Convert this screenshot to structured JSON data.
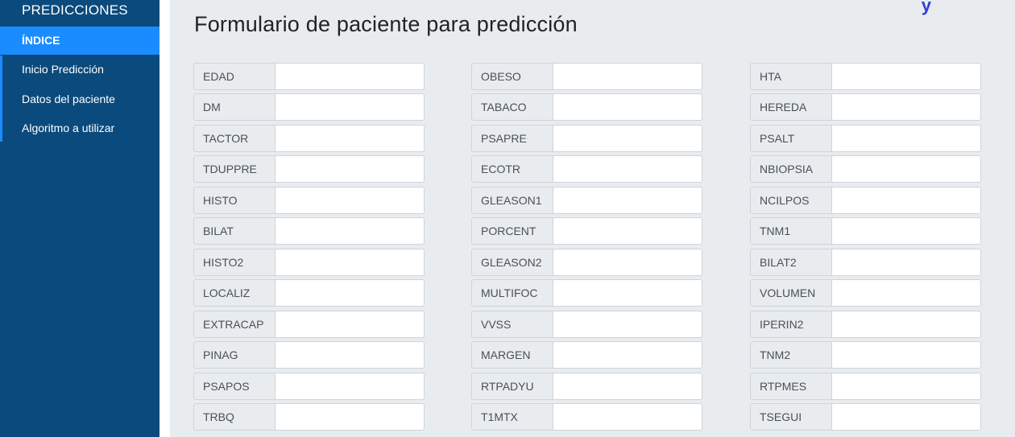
{
  "sidebar": {
    "title": "PREDICCIONES",
    "active_item": "ÍNDICE",
    "items": [
      {
        "label": "Inicio Predicción"
      },
      {
        "label": "Datos del paciente"
      },
      {
        "label": "Algoritmo a utilizar"
      }
    ]
  },
  "main": {
    "title": "Formulario de paciente para predicción",
    "corner_mark": "y"
  },
  "form": {
    "rows": [
      [
        "EDAD",
        "OBESO",
        "HTA"
      ],
      [
        "DM",
        "TABACO",
        "HEREDA"
      ],
      [
        "TACTOR",
        "PSAPRE",
        "PSALT"
      ],
      [
        "TDUPPRE",
        "ECOTR",
        "NBIOPSIA"
      ],
      [
        "HISTO",
        "GLEASON1",
        "NCILPOS"
      ],
      [
        "BILAT",
        "PORCENT",
        "TNM1"
      ],
      [
        "HISTO2",
        "GLEASON2",
        "BILAT2"
      ],
      [
        "LOCALIZ",
        "MULTIFOC",
        "VOLUMEN"
      ],
      [
        "EXTRACAP",
        "VVSS",
        "IPERIN2"
      ],
      [
        "PINAG",
        "MARGEN",
        "TNM2"
      ],
      [
        "PSAPOS",
        "RTPADYU",
        "RTPMES"
      ],
      [
        "TRBQ",
        "T1MTX",
        "TSEGUI"
      ]
    ]
  },
  "colors": {
    "sidebar_bg": "#0b4a7c",
    "sidebar_active": "#1a8cff",
    "main_bg": "#e9ecef"
  }
}
